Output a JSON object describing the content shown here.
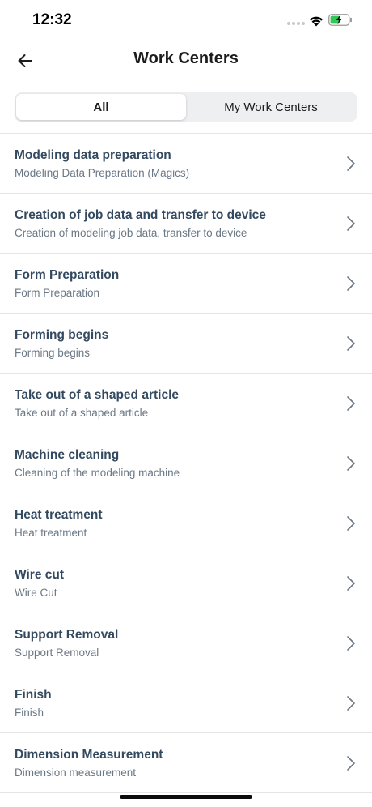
{
  "status_bar": {
    "time": "12:32"
  },
  "header": {
    "title": "Work Centers",
    "back_icon": "arrow-left-icon"
  },
  "tabs": [
    {
      "label": "All",
      "active": true
    },
    {
      "label": "My Work Centers",
      "active": false
    }
  ],
  "work_centers": [
    {
      "title": "Modeling data preparation",
      "subtitle": "Modeling Data Preparation (Magics)"
    },
    {
      "title": "Creation of job data and transfer to device",
      "subtitle": "Creation of modeling job data, transfer to device"
    },
    {
      "title": "Form Preparation",
      "subtitle": "Form Preparation"
    },
    {
      "title": "Forming begins",
      "subtitle": "Forming begins"
    },
    {
      "title": "Take out of a shaped article",
      "subtitle": "Take out of a shaped article"
    },
    {
      "title": "Machine cleaning",
      "subtitle": "Cleaning of the modeling machine"
    },
    {
      "title": "Heat treatment",
      "subtitle": "Heat treatment"
    },
    {
      "title": "Wire cut",
      "subtitle": "Wire Cut"
    },
    {
      "title": "Support Removal",
      "subtitle": "Support Removal"
    },
    {
      "title": "Finish",
      "subtitle": "Finish"
    },
    {
      "title": "Dimension Measurement",
      "subtitle": "Dimension measurement"
    }
  ],
  "colors": {
    "title_text": "#33495f",
    "subtitle_text": "#6b7886",
    "divider": "#e3e5e8",
    "segment_bg": "#eeeff1",
    "battery_charging": "#34c759"
  }
}
